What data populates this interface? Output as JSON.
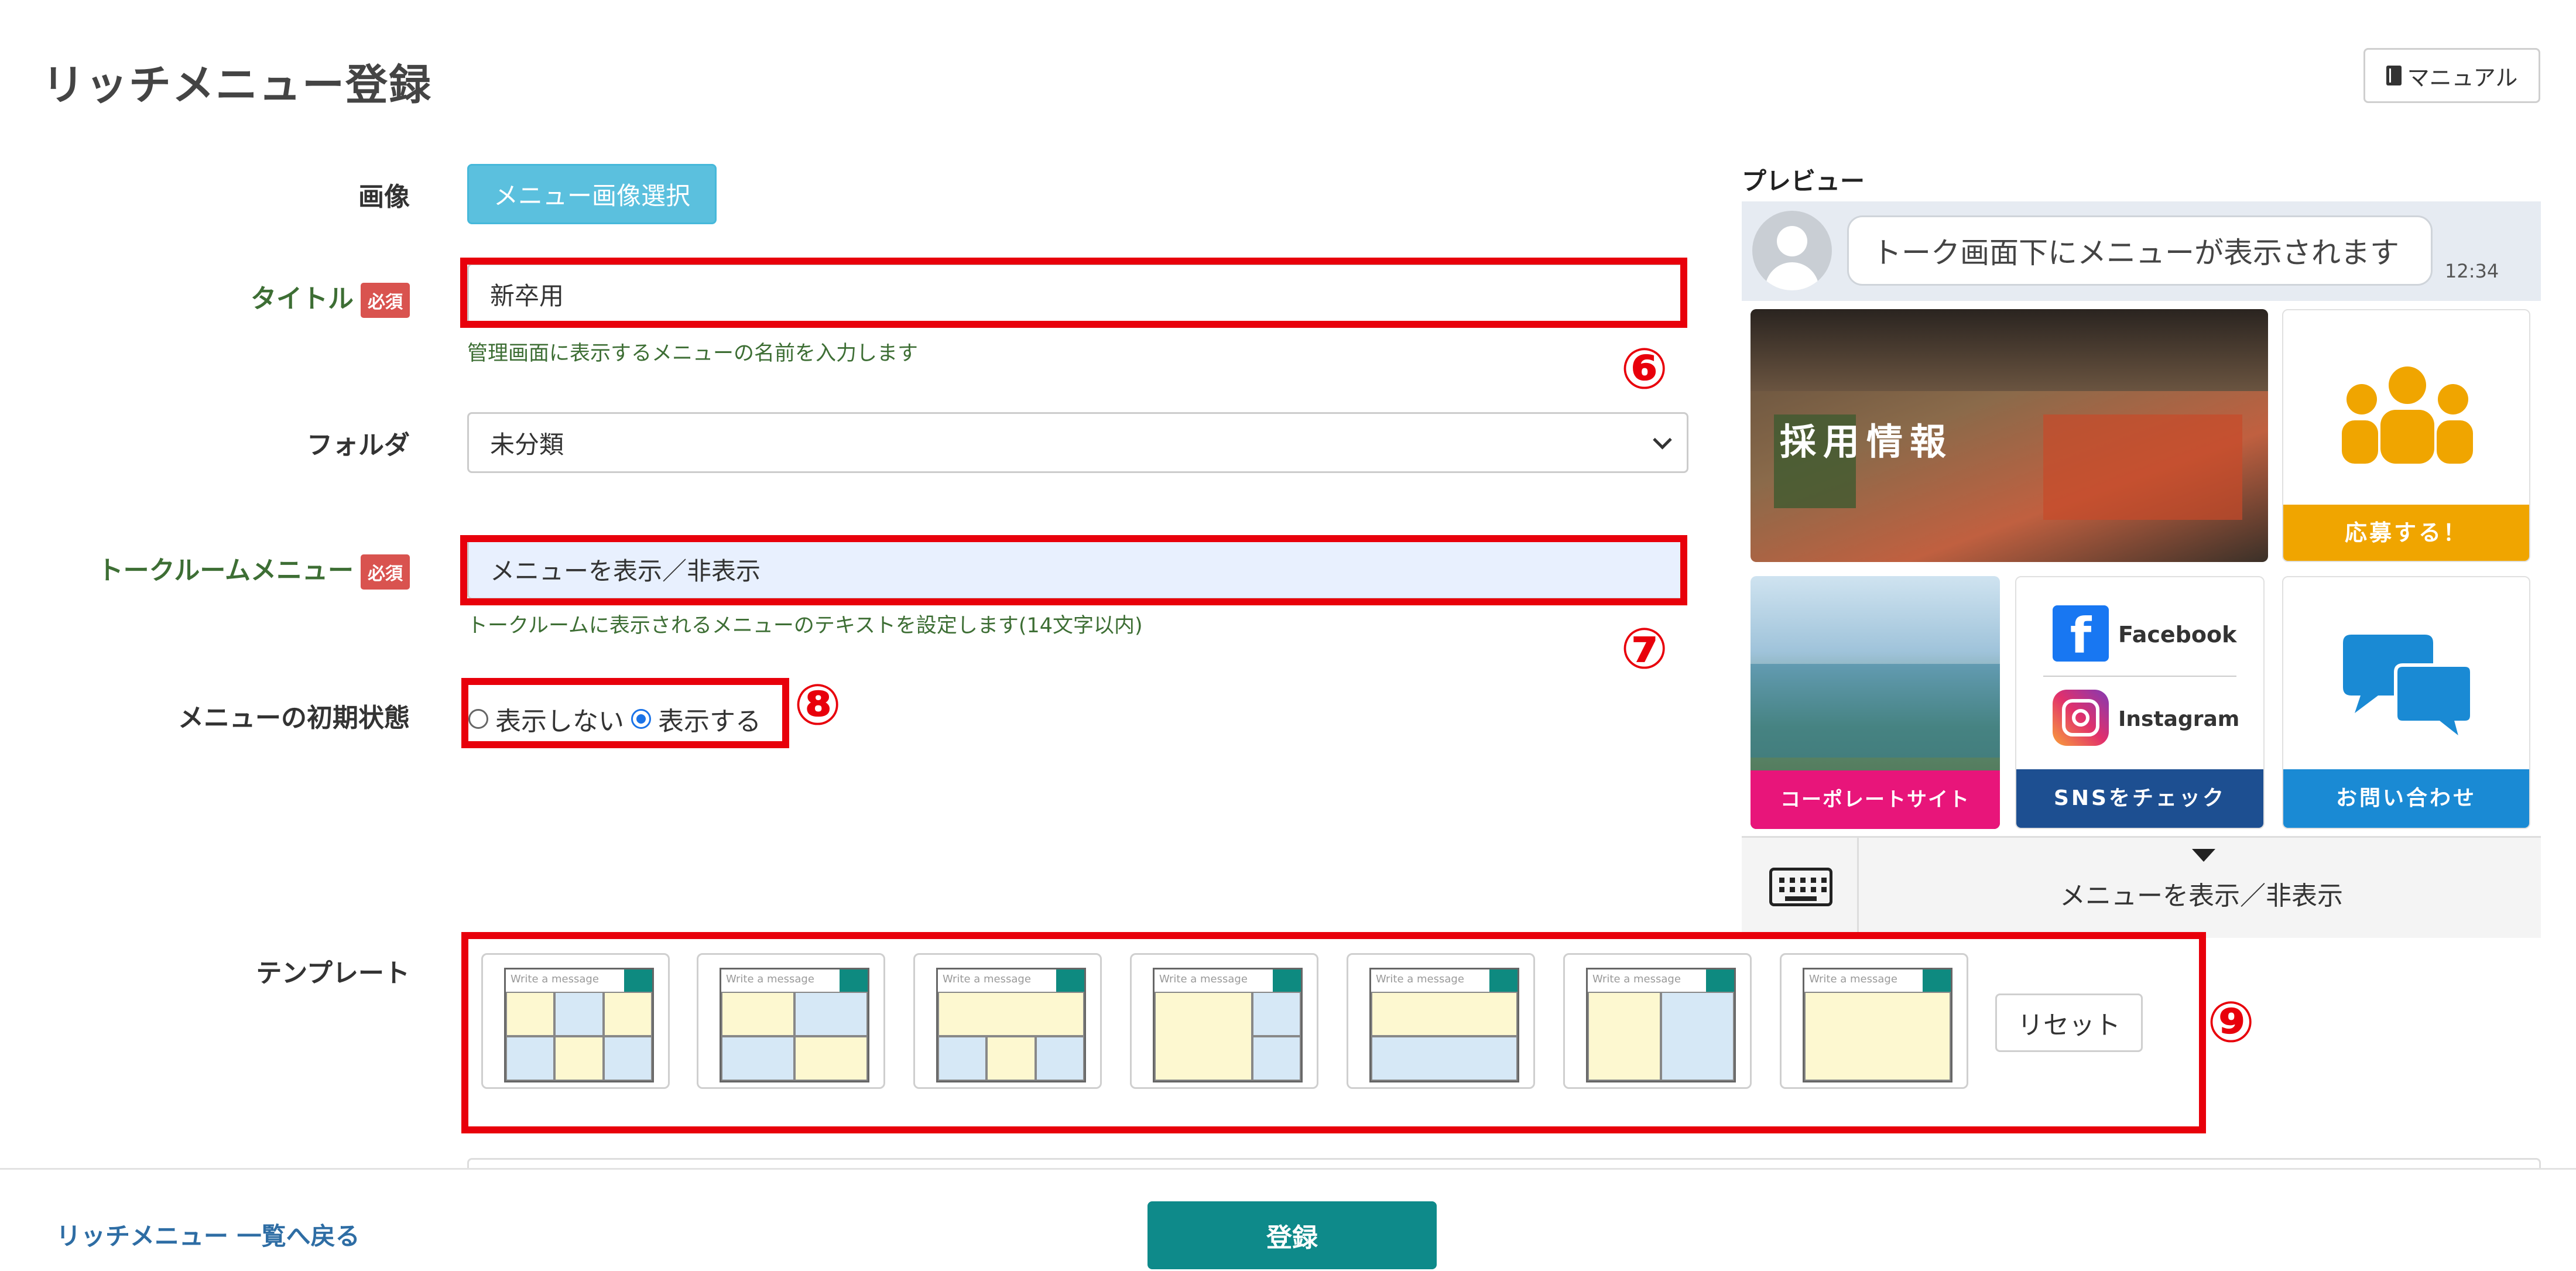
{
  "page": {
    "title": "リッチメニュー登録",
    "manual_label": "マニュアル"
  },
  "form": {
    "image": {
      "label": "画像",
      "button": "メニュー画像選択"
    },
    "title": {
      "label": "タイトル",
      "required": "必須",
      "value": "新卒用",
      "help": "管理画面に表示するメニューの名前を入力します"
    },
    "folder": {
      "label": "フォルダ",
      "selected": "未分類"
    },
    "talk_menu": {
      "label": "トークルームメニュー",
      "required": "必須",
      "value": "メニューを表示／非表示",
      "help": "トークルームに表示されるメニューのテキストを設定します(14文字以内)"
    },
    "initial_state": {
      "label": "メニューの初期状態",
      "options": [
        "表示しない",
        "表示する"
      ],
      "selected": "表示する"
    },
    "template": {
      "label": "テンプレート",
      "reset": "リセット",
      "placeholder_text": "Write a message"
    }
  },
  "annotations": [
    "⑥",
    "⑦",
    "⑧",
    "⑨"
  ],
  "preview": {
    "label": "プレビュー",
    "chat_message": "トーク画面下にメニューが表示されます",
    "time": "12:34",
    "tiles": {
      "recruit": "採用情報",
      "apply": "応募する！",
      "corporate": "コーポレートサイト",
      "facebook": "Facebook",
      "instagram": "Instagram",
      "sns": "SNSをチェック",
      "contact": "お問い合わせ"
    },
    "toggle_text": "メニューを表示／非表示"
  },
  "footer": {
    "back_link": "リッチメニュー 一覧へ戻る",
    "submit": "登録"
  },
  "colors": {
    "accent": "#0e8a8a",
    "required": "#d9534f",
    "highlight": "#e8000b",
    "label_green": "#3d6e34"
  }
}
